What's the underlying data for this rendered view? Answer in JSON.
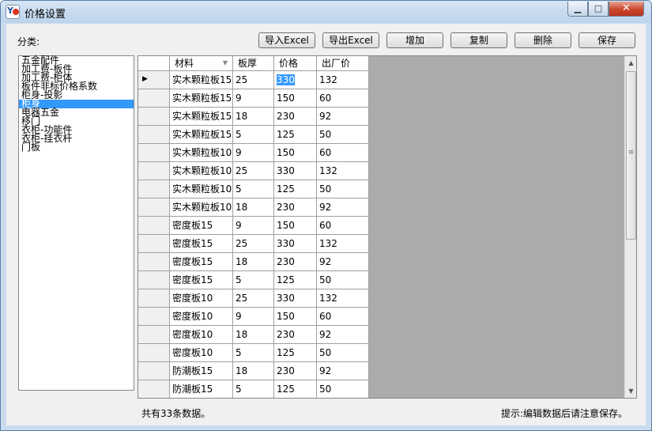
{
  "window": {
    "title": "价格设置",
    "minimize": "▁",
    "maximize": "□",
    "close": "✕"
  },
  "category_label": "分类:",
  "toolbar": {
    "import_excel": "导入Excel",
    "export_excel": "导出Excel",
    "add": "增加",
    "copy": "复制",
    "delete": "删除",
    "save": "保存"
  },
  "categories": [
    "五金配件",
    "加工费-板件",
    "加工费-柜体",
    "板件非标价格系数",
    "柜身-投影",
    "柜身",
    "电器五金",
    "移门",
    "衣柜-功能件",
    "衣柜-挂衣杆",
    "门板"
  ],
  "selected_category": "柜身",
  "table": {
    "columns": [
      "材料",
      "板厚",
      "价格",
      "出厂价"
    ],
    "sort_indicator": "▼",
    "current_row_marker": "▶",
    "rows": [
      [
        "实木颗粒板15",
        "25",
        "330",
        "132"
      ],
      [
        "实木颗粒板15",
        "9",
        "150",
        "60"
      ],
      [
        "实木颗粒板15",
        "18",
        "230",
        "92"
      ],
      [
        "实木颗粒板15",
        "5",
        "125",
        "50"
      ],
      [
        "实木颗粒板10",
        "9",
        "150",
        "60"
      ],
      [
        "实木颗粒板10",
        "25",
        "330",
        "132"
      ],
      [
        "实木颗粒板10",
        "5",
        "125",
        "50"
      ],
      [
        "实木颗粒板10",
        "18",
        "230",
        "92"
      ],
      [
        "密度板15",
        "9",
        "150",
        "60"
      ],
      [
        "密度板15",
        "25",
        "330",
        "132"
      ],
      [
        "密度板15",
        "18",
        "230",
        "92"
      ],
      [
        "密度板15",
        "5",
        "125",
        "50"
      ],
      [
        "密度板10",
        "25",
        "330",
        "132"
      ],
      [
        "密度板10",
        "9",
        "150",
        "60"
      ],
      [
        "密度板10",
        "18",
        "230",
        "92"
      ],
      [
        "密度板10",
        "5",
        "125",
        "50"
      ],
      [
        "防潮板15",
        "18",
        "230",
        "92"
      ],
      [
        "防潮板15",
        "5",
        "125",
        "50"
      ]
    ]
  },
  "scrollbar": {
    "up": "▲",
    "down": "▼",
    "grip": "≡"
  },
  "status": {
    "count": "共有33条数据。",
    "hint": "提示:编辑数据后请注意保存。"
  }
}
